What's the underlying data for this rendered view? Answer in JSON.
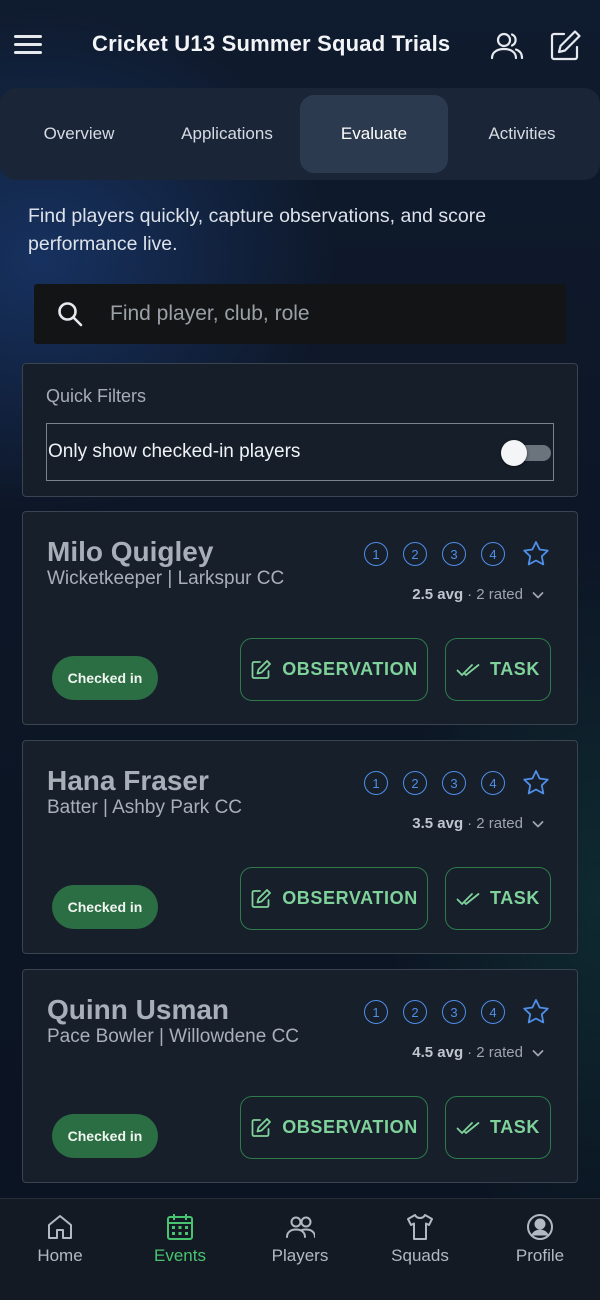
{
  "header": {
    "title": "Cricket U13 Summer Squad Trials",
    "menu_icon": "hamburger-menu-icon",
    "team_icon": "people-icon",
    "edit_icon": "edit-square-icon"
  },
  "tabs": [
    {
      "label": "Overview"
    },
    {
      "label": "Applications"
    },
    {
      "label": "Evaluate",
      "active": true
    },
    {
      "label": "Activities"
    }
  ],
  "intro": "Find players quickly, capture observations, and score performance live.",
  "search": {
    "placeholder": "Find player, club, role",
    "value": ""
  },
  "filters": {
    "title": "Quick Filters",
    "checked_in_label": "Only show checked-in players",
    "checked_in_enabled": false
  },
  "players": [
    {
      "name": "Milo Quigley",
      "role_club": "Wicketkeeper | Larkspur CC",
      "ratings": [
        "1",
        "2",
        "3",
        "4"
      ],
      "avg": "2.5 avg",
      "rated": "· 2 rated",
      "status": "Checked in",
      "observation_label": "OBSERVATION",
      "task_label": "TASK"
    },
    {
      "name": "Hana Fraser",
      "role_club": "Batter | Ashby Park CC",
      "ratings": [
        "1",
        "2",
        "3",
        "4"
      ],
      "avg": "3.5 avg",
      "rated": "· 2 rated",
      "status": "Checked in",
      "observation_label": "OBSERVATION",
      "task_label": "TASK"
    },
    {
      "name": "Quinn Usman",
      "role_club": "Pace Bowler | Willowdene CC",
      "ratings": [
        "1",
        "2",
        "3",
        "4"
      ],
      "avg": "4.5 avg",
      "rated": "· 2 rated",
      "status": "Checked in",
      "observation_label": "OBSERVATION",
      "task_label": "TASK"
    }
  ],
  "bottom_nav": [
    {
      "label": "Home",
      "icon": "home-icon"
    },
    {
      "label": "Events",
      "icon": "calendar-icon",
      "active": true
    },
    {
      "label": "Players",
      "icon": "people-icon"
    },
    {
      "label": "Squads",
      "icon": "shirt-icon"
    },
    {
      "label": "Profile",
      "icon": "profile-icon"
    }
  ],
  "colors": {
    "accent_green": "#47c46f",
    "rating_blue": "#4f8fe8",
    "badge_green": "#2c6e43"
  }
}
